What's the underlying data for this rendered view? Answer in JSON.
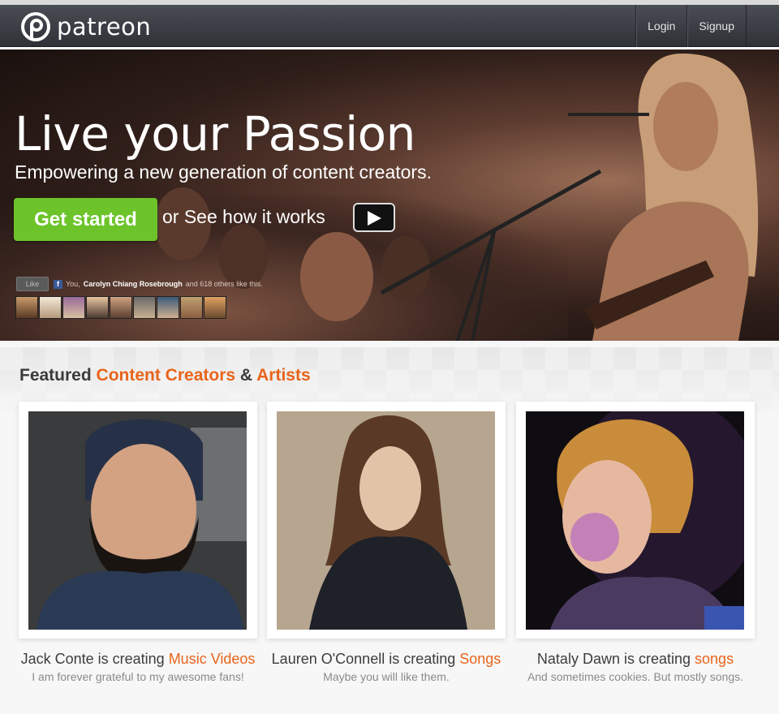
{
  "brand": {
    "name": "patreon"
  },
  "nav": {
    "login": "Login",
    "signup": "Signup"
  },
  "hero": {
    "title": "Live your Passion",
    "subtitle": "Empowering a new generation of content creators.",
    "cta": "Get started",
    "see_how": "or See how it works",
    "like": {
      "button": "Like",
      "you": "You,",
      "name": "Carolyn Chiang Rosebrough",
      "rest": "and 618 others like this."
    }
  },
  "featured": {
    "prefix": "Featured",
    "accent1": "Content Creators",
    "amp": "&",
    "accent2": "Artists"
  },
  "creators": [
    {
      "name": "Jack Conte is creating",
      "category": "Music Videos",
      "tagline": "I am forever grateful to my awesome fans!"
    },
    {
      "name": "Lauren O'Connell is creating",
      "category": "Songs",
      "tagline": "Maybe you will like them."
    },
    {
      "name": "Nataly Dawn is creating",
      "category": "songs",
      "tagline": "And sometimes cookies. But mostly songs."
    }
  ],
  "colors": {
    "accent": "#e8641b",
    "cta": "#6cc42a",
    "navbar": "#3a3c42",
    "facebook": "#3b5998"
  }
}
